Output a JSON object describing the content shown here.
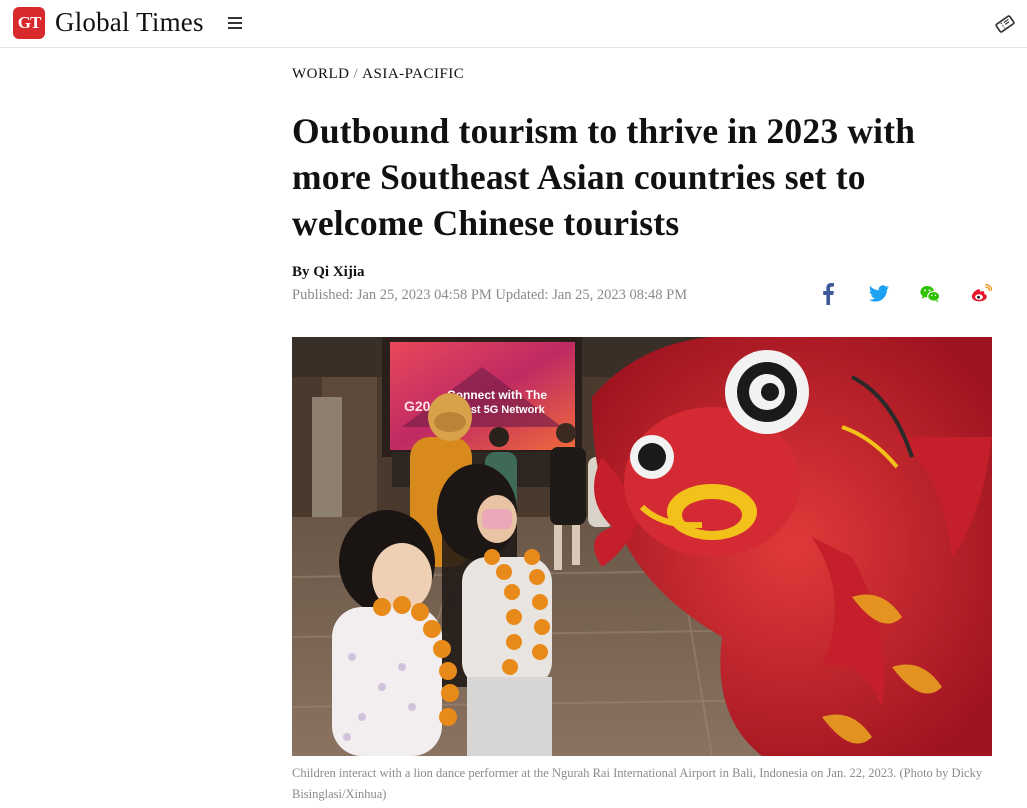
{
  "header": {
    "logo_badge": "GT",
    "logo_text": "Global Times",
    "menu_icon": "hamburger-menu-icon",
    "right_icon": "ticket-icon"
  },
  "article": {
    "section": "WORLD",
    "section_separator": "/",
    "subsection": "ASIA-PACIFIC",
    "headline": "Outbound tourism to thrive in 2023 with more Southeast Asian countries set to welcome Chinese tourists",
    "byline": "By Qi Xijia",
    "published": "Published: Jan 25, 2023 04:58 PM Updated: Jan 25, 2023 08:48 PM",
    "share": {
      "facebook_icon": "facebook-icon",
      "twitter_icon": "twitter-icon",
      "wechat_icon": "wechat-icon",
      "weibo_icon": "weibo-icon"
    },
    "photo": {
      "screen_text_1": "Connect with The",
      "screen_text_2": "Fastest 5G Network",
      "screen_logo": "G20"
    },
    "caption": "Children interact with a lion dance performer at the Ngurah Rai International Airport in Bali, Indonesia on Jan. 22, 2023. (Photo by Dicky Bisinglasi/Xinhua)"
  },
  "colors": {
    "brand_red": "#d8292c",
    "facebook": "#3b5998",
    "twitter": "#1da1f2",
    "wechat": "#2dc100",
    "weibo": "#e6162d",
    "meta_gray": "#8a8a8a"
  }
}
